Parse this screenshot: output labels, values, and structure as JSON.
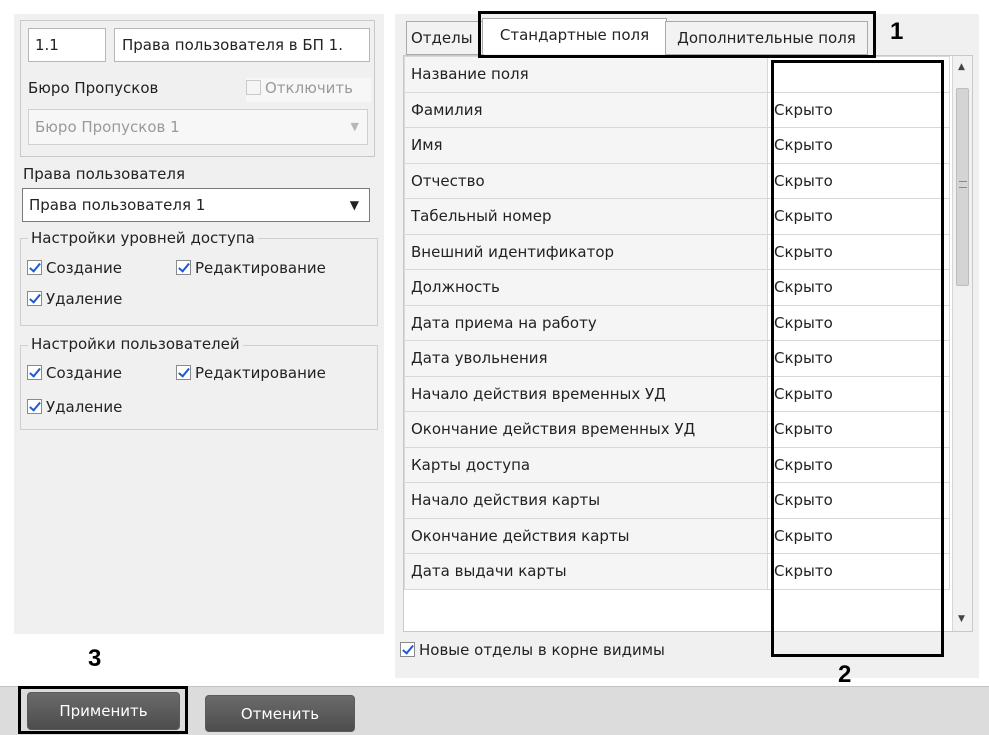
{
  "header": {
    "section_name": "1.1",
    "section_title": "Права пользователя в БП 1."
  },
  "bureau": {
    "label": "Бюро Пропусков",
    "disable_label": "Отключить",
    "disable_checked": false,
    "select_value": "Бюро Пропусков 1"
  },
  "rights": {
    "label": "Права пользователя",
    "select_value": "Права пользователя 1"
  },
  "access_levels": {
    "legend": "Настройки уровней доступа",
    "create": "Создание",
    "edit": "Редактирование",
    "delete": "Удаление"
  },
  "users": {
    "legend": "Настройки пользователей",
    "create": "Создание",
    "edit": "Редактирование",
    "delete": "Удаление"
  },
  "tabs": [
    {
      "label": "Отделы"
    },
    {
      "label": "Стандартные поля"
    },
    {
      "label": "Дополнительные поля"
    }
  ],
  "grid": {
    "header": "Название поля",
    "rows": [
      {
        "name": "Фамилия",
        "value": "Скрыто"
      },
      {
        "name": "Имя",
        "value": "Скрыто"
      },
      {
        "name": "Отчество",
        "value": "Скрыто"
      },
      {
        "name": "Табельный номер",
        "value": "Скрыто"
      },
      {
        "name": "Внешний идентификатор",
        "value": "Скрыто"
      },
      {
        "name": "Должность",
        "value": "Скрыто"
      },
      {
        "name": "Дата приема на работу",
        "value": "Скрыто"
      },
      {
        "name": "Дата увольнения",
        "value": "Скрыто"
      },
      {
        "name": "Начало действия временных УД",
        "value": "Скрыто"
      },
      {
        "name": "Окончание действия временных УД",
        "value": "Скрыто"
      },
      {
        "name": "Карты доступа",
        "value": "Скрыто"
      },
      {
        "name": "Начало действия карты",
        "value": "Скрыто"
      },
      {
        "name": "Окончание действия карты",
        "value": "Скрыто"
      },
      {
        "name": "Дата выдачи карты",
        "value": "Скрыто"
      }
    ]
  },
  "new_departments_label": "Новые отделы в корне видимы",
  "buttons": {
    "apply": "Применить",
    "cancel": "Отменить"
  },
  "annotations": {
    "a1": "1",
    "a2": "2",
    "a3": "3"
  }
}
